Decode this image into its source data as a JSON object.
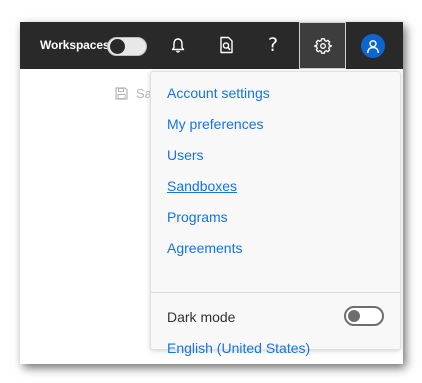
{
  "topbar": {
    "workspaces_label": "Workspaces",
    "workspaces_toggle_on": false,
    "help_glyph": "?",
    "icons": [
      "bell-icon",
      "document-search-icon",
      "help-icon",
      "gear-icon",
      "user-avatar-icon"
    ]
  },
  "background": {
    "save_partial_label": "Sa"
  },
  "settings_menu": {
    "items": [
      {
        "label": "Account settings"
      },
      {
        "label": "My preferences"
      },
      {
        "label": "Users"
      },
      {
        "label": "Sandboxes"
      },
      {
        "label": "Programs"
      },
      {
        "label": "Agreements"
      }
    ],
    "dark_mode_label": "Dark mode",
    "dark_mode_on": false,
    "language_label": "English (United States)"
  },
  "colors": {
    "topbar_bg": "#292929",
    "link": "#1473e6",
    "avatar": "#0d66d0",
    "menu_bg": "#f8f8f8"
  }
}
